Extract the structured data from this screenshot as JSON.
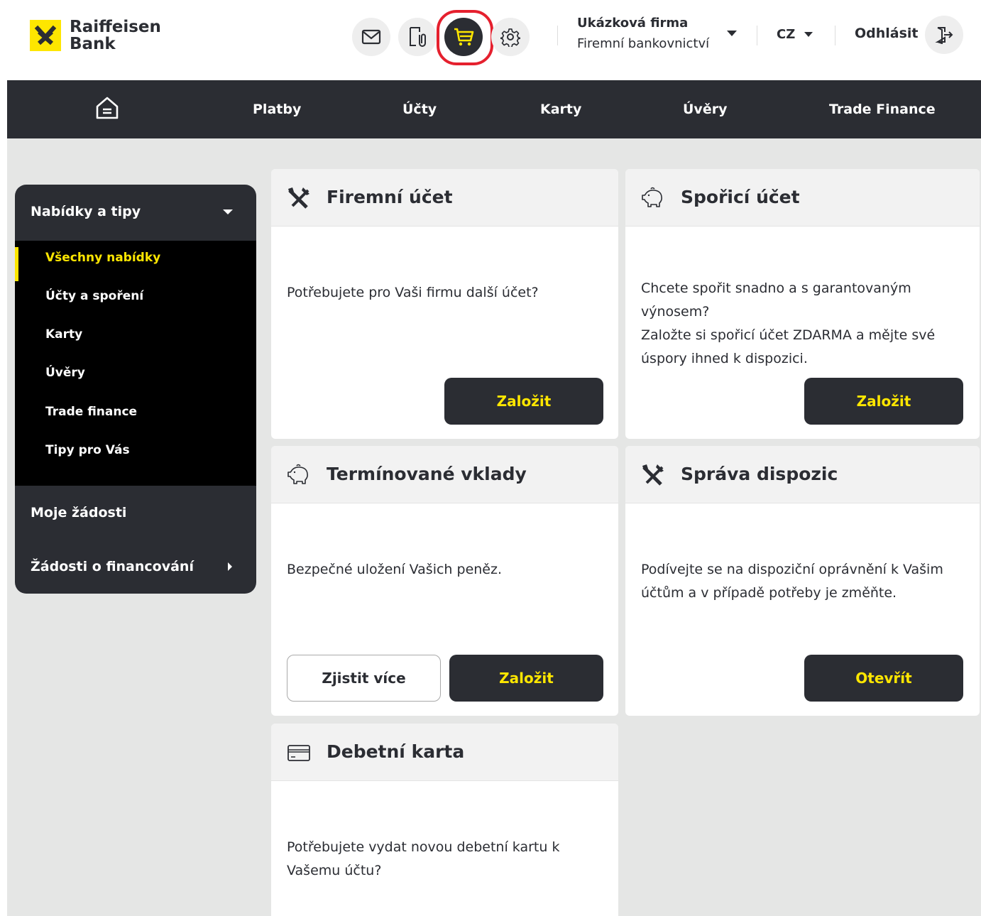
{
  "brand": {
    "name_line1": "Raiffeisen",
    "name_line2": "Bank",
    "accent": "#fee600",
    "dark": "#2b2d33"
  },
  "header": {
    "icons": [
      "mail-icon",
      "document-attachment-icon",
      "cart-icon",
      "gear-icon"
    ],
    "company_name": "Ukázková firma",
    "company_sub": "Firemní bankovnictví",
    "language": "CZ",
    "logout_label": "Odhlásit"
  },
  "nav": {
    "items": [
      {
        "label": "Platby"
      },
      {
        "label": "Účty"
      },
      {
        "label": "Karty"
      },
      {
        "label": "Úvěry"
      },
      {
        "label": "Trade Finance"
      }
    ]
  },
  "sidebar": {
    "section_title": "Nabídky a tipy",
    "items": [
      {
        "label": "Všechny nabídky",
        "active": true
      },
      {
        "label": "Účty a spoření"
      },
      {
        "label": "Karty"
      },
      {
        "label": "Úvěry"
      },
      {
        "label": "Trade finance"
      },
      {
        "label": "Tipy pro Vás"
      }
    ],
    "sections": [
      {
        "label": "Moje žádosti"
      },
      {
        "label": "Žádosti o financování"
      }
    ]
  },
  "cards": [
    {
      "title": "Firemní účet",
      "icon": "tools-icon",
      "text": "Potřebujete pro Vaši firmu další účet?",
      "primary": "Založit"
    },
    {
      "title": "Spořicí účet",
      "icon": "piggy-bank-icon",
      "text_lines": [
        "Chcete spořit snadno a s garantovaným",
        "výnosem?",
        "Založte si spořicí účet ZDARMA a mějte své",
        "úspory ihned k dispozici."
      ],
      "primary": "Založit"
    },
    {
      "title": "Termínované vklady",
      "icon": "piggy-bank-icon",
      "text": "Bezpečné uložení Vašich peněz.",
      "secondary": "Zjistit více",
      "primary": "Založit"
    },
    {
      "title": "Správa dispozic",
      "icon": "tools-icon",
      "text_lines": [
        "Podívejte se na dispoziční oprávnění k Vašim",
        "účtům a v případě potřeby je změňte."
      ],
      "primary": "Otevřít"
    },
    {
      "title": "Debetní karta",
      "icon": "credit-card-icon",
      "text_lines": [
        "Potřebujete vydat novou debetní kartu k",
        "Vašemu účtu?"
      ]
    }
  ]
}
